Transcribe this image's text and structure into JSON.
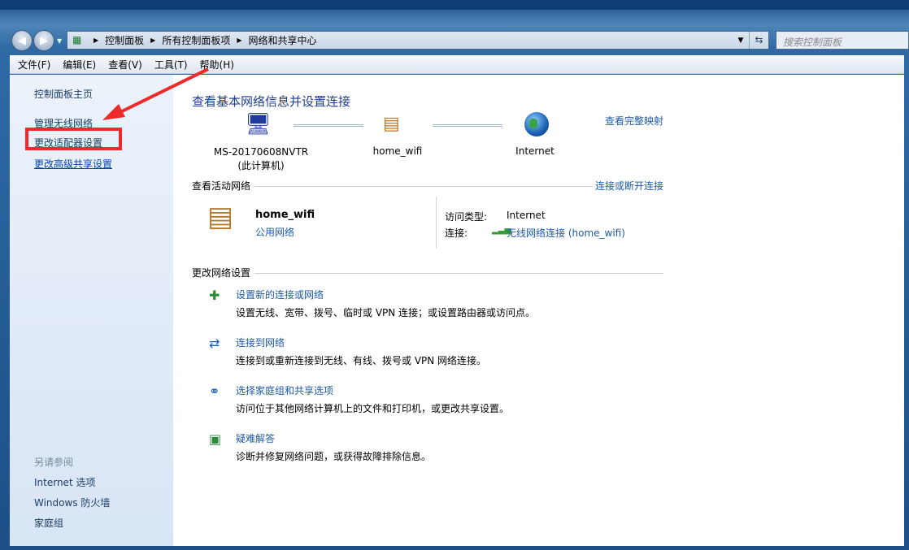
{
  "window": {
    "breadcrumb": [
      "控制面板",
      "所有控制面板项",
      "网络和共享中心"
    ],
    "search_placeholder": "搜索控制面板"
  },
  "menu": [
    "文件(F)",
    "编辑(E)",
    "查看(V)",
    "工具(T)",
    "帮助(H)"
  ],
  "sidebar": {
    "items": [
      "控制面板主页",
      "管理无线网络",
      "更改适配器设置",
      "更改高级共享设置"
    ],
    "see_also": "另请参阅",
    "see_also_items": [
      "Internet 选项",
      "Windows 防火墙",
      "家庭组"
    ]
  },
  "main": {
    "title": "查看基本网络信息并设置连接",
    "view_full_map": "查看完整映射",
    "map": {
      "computer": "MS-20170608NVTR",
      "computer_sub": "(此计算机)",
      "network": "home_wifi",
      "internet": "Internet"
    },
    "active_header": "查看活动网络",
    "connect_disconnect": "连接或断开连接",
    "active": {
      "name": "home_wifi",
      "type": "公用网络",
      "access_label": "访问类型:",
      "access_value": "Internet",
      "conn_label": "连接:",
      "conn_value": "无线网络连接 (home_wifi)"
    },
    "settings_header": "更改网络设置",
    "tasks": [
      {
        "title": "设置新的连接或网络",
        "desc": "设置无线、宽带、拨号、临时或 VPN 连接；或设置路由器或访问点。"
      },
      {
        "title": "连接到网络",
        "desc": "连接到或重新连接到无线、有线、拨号或 VPN 网络连接。"
      },
      {
        "title": "选择家庭组和共享选项",
        "desc": "访问位于其他网络计算机上的文件和打印机，或更改共享设置。"
      },
      {
        "title": "疑难解答",
        "desc": "诊断并修复网络问题，或获得故障排除信息。"
      }
    ]
  },
  "colors": {
    "link": "#1e5aa8",
    "annotation": "#ee2b2b"
  }
}
